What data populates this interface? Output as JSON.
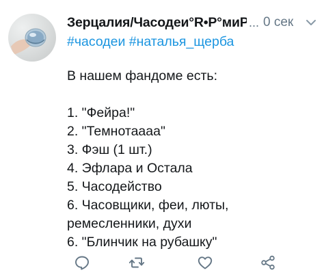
{
  "post": {
    "author": "Зерцалия/Часодеи°R•P°миР",
    "truncation": "...",
    "timestamp": "0 сек",
    "hashtags": [
      "#часодеи",
      "#наталья_щерба"
    ],
    "lines": [
      "В нашем фандоме есть:",
      "",
      "1. \"Фейра!\"",
      "2. \"Темнотаааа\"",
      "3. Фэш (1 шт.)",
      "4. Эфлара и Остала",
      "5. Часодейство",
      "6. Часовщики, феи, люты,",
      "ремесленники, духи",
      "6. \"Блинчик на рубашку\""
    ]
  },
  "icons": {
    "avatar": "avatar-image",
    "caret": "chevron-down-icon",
    "reply": "reply-icon",
    "retweet": "retweet-icon",
    "like": "heart-icon",
    "share": "share-icon"
  },
  "colors": {
    "text": "#14171a",
    "secondary": "#657786",
    "link": "#1b95e0"
  }
}
